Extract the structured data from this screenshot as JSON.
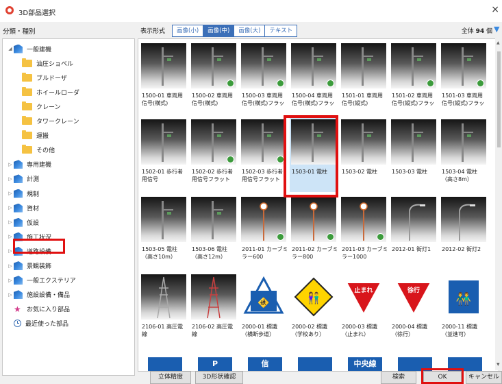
{
  "window": {
    "title": "3D部品選択",
    "close": "×"
  },
  "left_header": "分類・種別",
  "tree": [
    {
      "label": "一般建機",
      "icon": "building-icon",
      "expander": "◢",
      "indent": 0
    },
    {
      "label": "油圧ショベル",
      "icon": "folder-icon",
      "expander": "",
      "indent": 1
    },
    {
      "label": "ブルドーザ",
      "icon": "folder-icon",
      "expander": "",
      "indent": 1
    },
    {
      "label": "ホイールローダ",
      "icon": "folder-icon",
      "expander": "",
      "indent": 1
    },
    {
      "label": "クレーン",
      "icon": "folder-icon",
      "expander": "",
      "indent": 1
    },
    {
      "label": "タワークレーン",
      "icon": "folder-icon",
      "expander": "",
      "indent": 1
    },
    {
      "label": "運搬",
      "icon": "folder-icon",
      "expander": "",
      "indent": 1
    },
    {
      "label": "その他",
      "icon": "folder-icon",
      "expander": "",
      "indent": 1
    },
    {
      "label": "専用建機",
      "icon": "building-icon",
      "expander": "▷",
      "indent": 0
    },
    {
      "label": "計測",
      "icon": "building-icon",
      "expander": "▷",
      "indent": 0
    },
    {
      "label": "規制",
      "icon": "building-icon",
      "expander": "▷",
      "indent": 0
    },
    {
      "label": "資材",
      "icon": "building-icon",
      "expander": "▷",
      "indent": 0
    },
    {
      "label": "仮設",
      "icon": "building-icon",
      "expander": "▷",
      "indent": 0
    },
    {
      "label": "施工状況",
      "icon": "building-icon",
      "expander": "▷",
      "indent": 0
    },
    {
      "label": "道路設備",
      "icon": "building-icon",
      "expander": "▷",
      "indent": 0
    },
    {
      "label": "景観装飾",
      "icon": "building-icon",
      "expander": "▷",
      "indent": 0
    },
    {
      "label": "一般エクステリア",
      "icon": "building-icon",
      "expander": "▷",
      "indent": 0
    },
    {
      "label": "施設設備・備品",
      "icon": "building-icon",
      "expander": "▷",
      "indent": 0
    },
    {
      "label": "お気に入り部品",
      "icon": "pin-icon",
      "expander": "",
      "indent": 0
    },
    {
      "label": "最近使った部品",
      "icon": "clock-icon",
      "expander": "",
      "indent": 0
    }
  ],
  "toolbar": {
    "display_label": "表示形式",
    "modes": [
      "画像(小)",
      "画像(中)",
      "画像(大)",
      "テキスト"
    ],
    "active_mode": "画像(中)",
    "total_prefix": "全体",
    "total_count": "94",
    "total_suffix": "個"
  },
  "items": [
    {
      "label": "1500-01 車両用\n信号(横式)",
      "type": "pole",
      "badge": false
    },
    {
      "label": "1500-02 車両用\n信号(横式)",
      "type": "pole",
      "badge": true
    },
    {
      "label": "1500-03 車両用\n信号(横式)フラッ",
      "type": "pole",
      "badge": true
    },
    {
      "label": "1500-04 車両用\n信号(横式)フラッ",
      "type": "pole",
      "badge": true
    },
    {
      "label": "1501-01 車両用\n信号(縦式)",
      "type": "pole",
      "badge": false
    },
    {
      "label": "1501-02 車両用\n信号(縦式)フラッ",
      "type": "pole",
      "badge": true
    },
    {
      "label": "1501-03 車両用\n信号(縦式)フラッ",
      "type": "pole",
      "badge": true
    },
    {
      "label": "1502-01 歩行者\n用信号",
      "type": "pole",
      "badge": false
    },
    {
      "label": "1502-02 歩行者\n用信号フラット",
      "type": "pole",
      "badge": true
    },
    {
      "label": "1502-03 歩行者\n用信号フラット",
      "type": "pole",
      "badge": true
    },
    {
      "label": "1503-01 電柱",
      "type": "pole",
      "badge": false
    },
    {
      "label": "1503-02 電柱",
      "type": "pole",
      "badge": false
    },
    {
      "label": "1503-03 電柱",
      "type": "pole",
      "badge": false
    },
    {
      "label": "1503-04 電柱\n（高さ8m）",
      "type": "pole",
      "badge": false
    },
    {
      "label": "1503-05 電柱\n（高さ10m）",
      "type": "pole",
      "badge": false
    },
    {
      "label": "1503-06 電柱\n（高さ12m）",
      "type": "pole",
      "badge": false
    },
    {
      "label": "2011-01 カーブミ\nラー600",
      "type": "mirror",
      "badge": true
    },
    {
      "label": "2011-02 カーブミ\nラー800",
      "type": "mirror",
      "badge": true
    },
    {
      "label": "2011-03 カーブミ\nラー1000",
      "type": "mirror",
      "badge": true
    },
    {
      "label": "2012-01 街灯1",
      "type": "lamp",
      "badge": false
    },
    {
      "label": "2012-02 街灯2",
      "type": "lamp",
      "badge": false
    },
    {
      "label": "2106-01 高圧電\n線",
      "type": "tower",
      "badge": false
    },
    {
      "label": "2106-02 高圧電\n線",
      "type": "tower-red",
      "badge": false
    },
    {
      "label": "2000-01 標識\n（横断歩道）",
      "type": "sign-crosswalk",
      "badge": false
    },
    {
      "label": "2000-02 標識\n（学校あり）",
      "type": "sign-school",
      "badge": false
    },
    {
      "label": "2000-03 標識\n（止まれ）",
      "type": "sign-stop",
      "badge": false
    },
    {
      "label": "2000-04 標識\n（徐行）",
      "type": "sign-slow",
      "badge": false
    },
    {
      "label": "2000-11 標識\n（並進可）",
      "type": "sign-walk",
      "badge": false
    }
  ],
  "sign_texts": {
    "stop": "止まれ",
    "slow": "徐行"
  },
  "bottom_row_texts": [
    "P",
    "信",
    "中央線"
  ],
  "selected_index": 10,
  "buttons": {
    "solid_precision": "立体精度",
    "shape_confirm": "3D形状確認",
    "search": "検索",
    "ok": "OK",
    "cancel": "キャンセル"
  },
  "colors": {
    "accent": "#3b6fb8",
    "selection": "#cde4f7",
    "highlight_box": "#e01010"
  }
}
